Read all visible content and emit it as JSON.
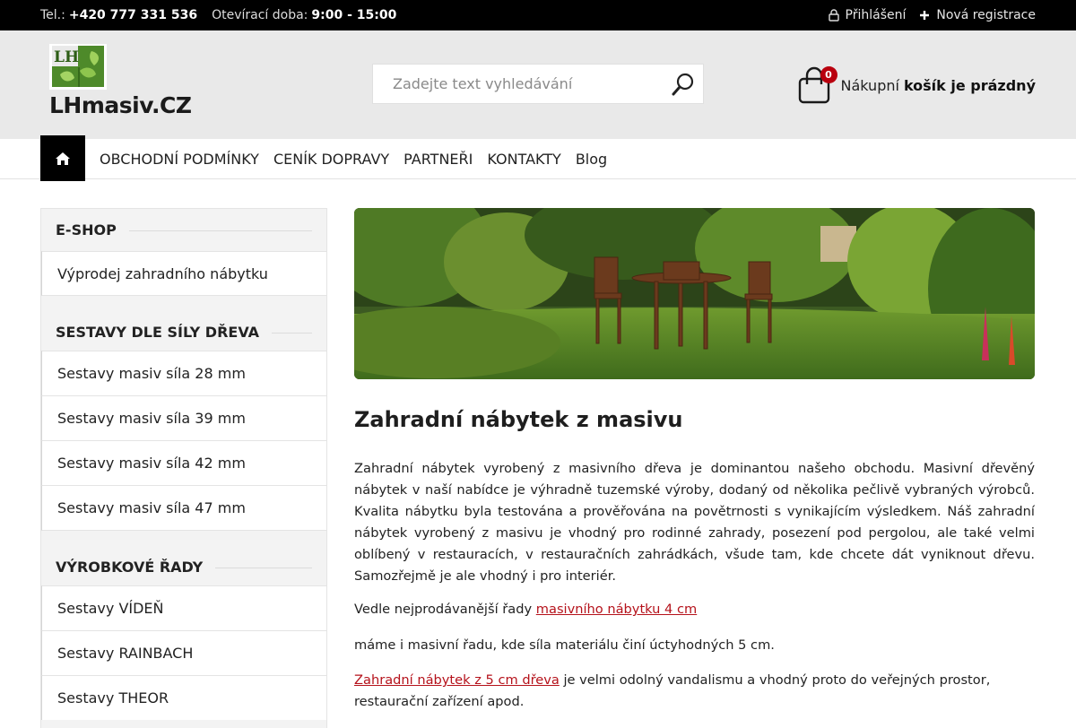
{
  "topbar": {
    "phone_label": "Tel.:",
    "phone": "+420 777 331 536",
    "hours_label": "Otevírací doba:",
    "hours": "9:00 - 15:00",
    "login": "Přihlášení",
    "register": "Nová registrace"
  },
  "header": {
    "logo_text": "LHmasiv.CZ",
    "logo_mark_text": "LH",
    "search_placeholder": "Zadejte text vyhledávání",
    "cart_count": "0",
    "cart_label": "Nákupní",
    "cart_status": "košík je prázdný"
  },
  "nav": {
    "items": [
      "OBCHODNÍ PODMÍNKY",
      "CENÍK DOPRAVY",
      "PARTNEŘI",
      "KONTAKTY",
      "Blog"
    ]
  },
  "sidebar": {
    "eshop_title": "E-SHOP",
    "eshop_items": [
      "Výprodej zahradního nábytku"
    ],
    "strength_title": "SESTAVY DLE SÍLY DŘEVA",
    "strength_items": [
      "Sestavy masiv síla 28 mm",
      "Sestavy masiv síla 39 mm",
      "Sestavy masiv síla 42 mm",
      "Sestavy masiv síla 47 mm"
    ],
    "series_title": "VÝROBKOVÉ ŘADY",
    "series_items": [
      "Sestavy VÍDEŇ",
      "Sestavy RAINBACH",
      "Sestavy THEOR"
    ]
  },
  "main": {
    "title": "Zahradní nábytek z masivu",
    "paragraph": "Zahradní nábytek vyrobený z masivního dřeva je dominantou našeho obchodu. Masivní dřevěný nábytek v naší nabídce je výhradně tuzemské výroby, dodaný od několika pečlivě vybraných výrobců. Kvalita nábytku byla testována a prověřována na povětrnosti s vynikajícím výsledkem. Náš zahradní nábytek vyrobený z masivu je vhodný pro rodinné zahrady, posezení pod pergolou, ale také velmi oblíbený v restauracích, v restauračních zahrádkách, všude tam, kde chcete dát vyniknout dřevu. Samozřejmě je ale vhodný i pro interiér.",
    "line1_text": "Vedle nejprodávanější řady",
    "line1_link": "masivního nábytku 4 cm",
    "line2_text": "máme i masivní řadu, kde síla materiálu činí úctyhodných 5 cm.",
    "line3_link": "Zahradní nábytek z 5 cm dřeva",
    "line3_text": "je velmi odolný vandalismu a vhodný proto do veřejných prostor, restaurační zařízení apod."
  },
  "colors": {
    "topbar_bg": "#000000",
    "header_bg": "#e9e9e9",
    "badge": "#b9000e",
    "link": "#b5121b"
  }
}
